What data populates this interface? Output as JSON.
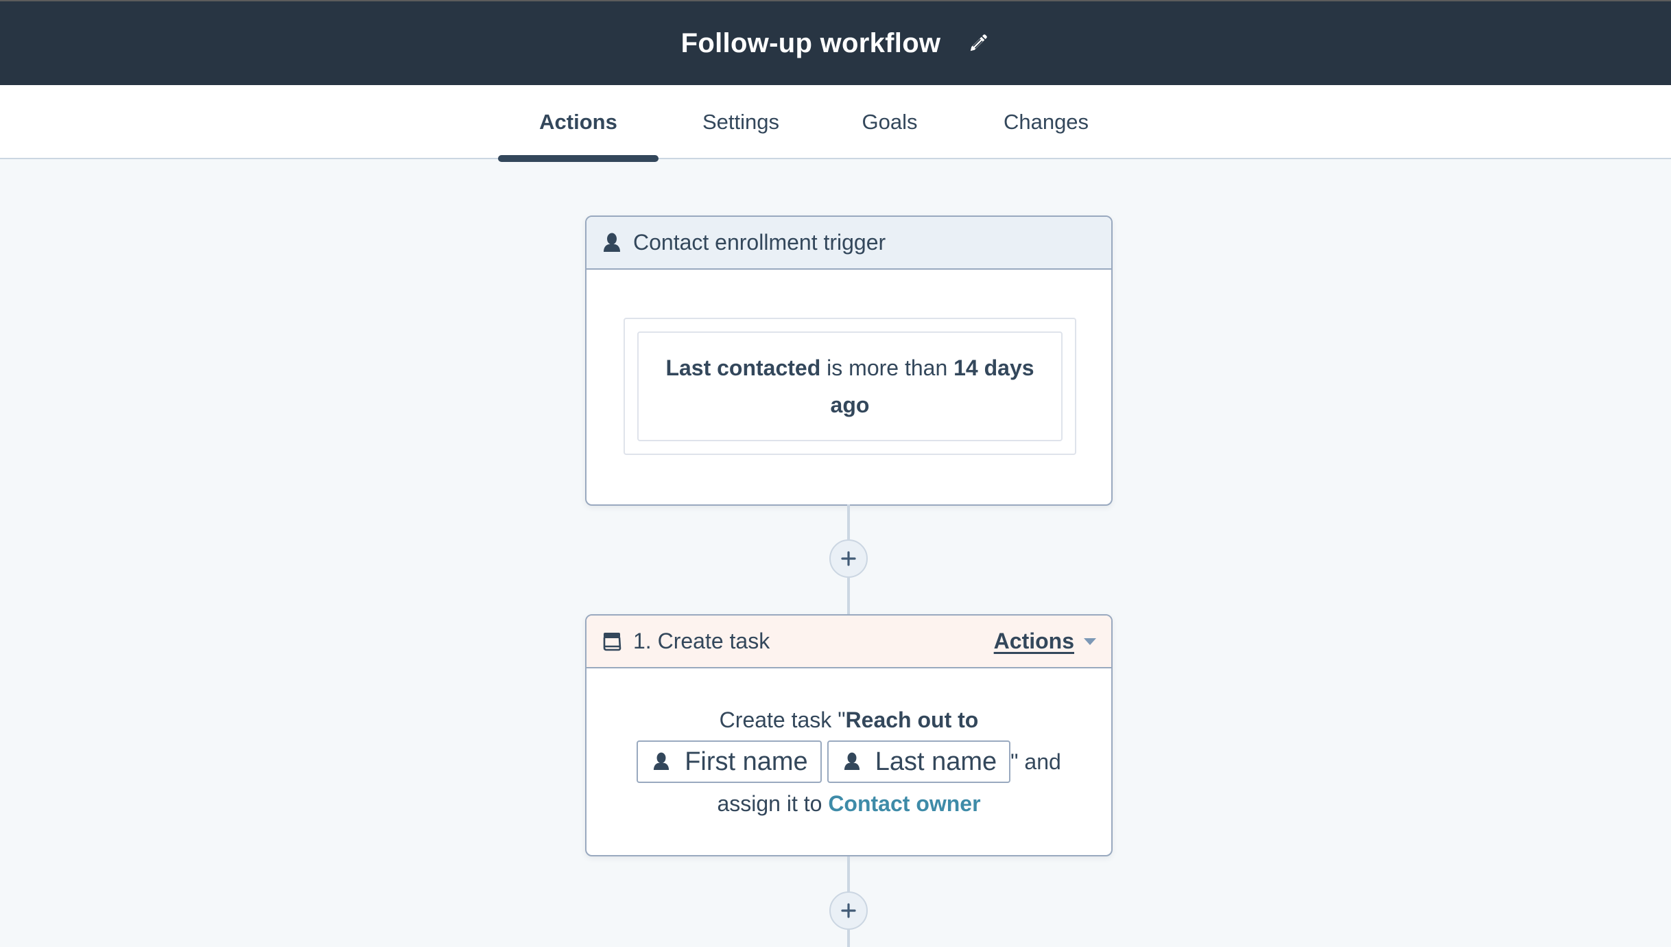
{
  "header": {
    "title": "Follow-up workflow",
    "edit_icon": "pencil-icon"
  },
  "tabs": [
    {
      "label": "Actions",
      "active": true
    },
    {
      "label": "Settings",
      "active": false
    },
    {
      "label": "Goals",
      "active": false
    },
    {
      "label": "Changes",
      "active": false
    }
  ],
  "trigger": {
    "icon": "contact-icon",
    "title": "Contact enrollment trigger",
    "filter": {
      "property": "Last contacted",
      "operator": " is more than ",
      "value": "14 days ago"
    }
  },
  "add_action": {
    "icon": "plus-icon"
  },
  "action": {
    "icon": "task-icon",
    "title": "1. Create task",
    "menu_label": "Actions",
    "menu_icon": "caret-down-icon",
    "body": {
      "prefix": "Create task \"",
      "task_name": "Reach out to",
      "tokens": [
        {
          "icon": "contact-icon",
          "label": "First name"
        },
        {
          "icon": "contact-icon",
          "label": "Last name"
        }
      ],
      "suffix": "\" and",
      "assign_prefix": "assign it to ",
      "assignee": "Contact owner"
    }
  },
  "colors": {
    "header_bg": "#283543",
    "text": "#33475b",
    "trigger_header_bg": "#eaf0f6",
    "action_header_bg": "#fdf3ef",
    "link": "#3e8ba8",
    "border": "#99a9bf",
    "connector": "#cbd6e2",
    "canvas_bg": "#f5f8fa"
  }
}
